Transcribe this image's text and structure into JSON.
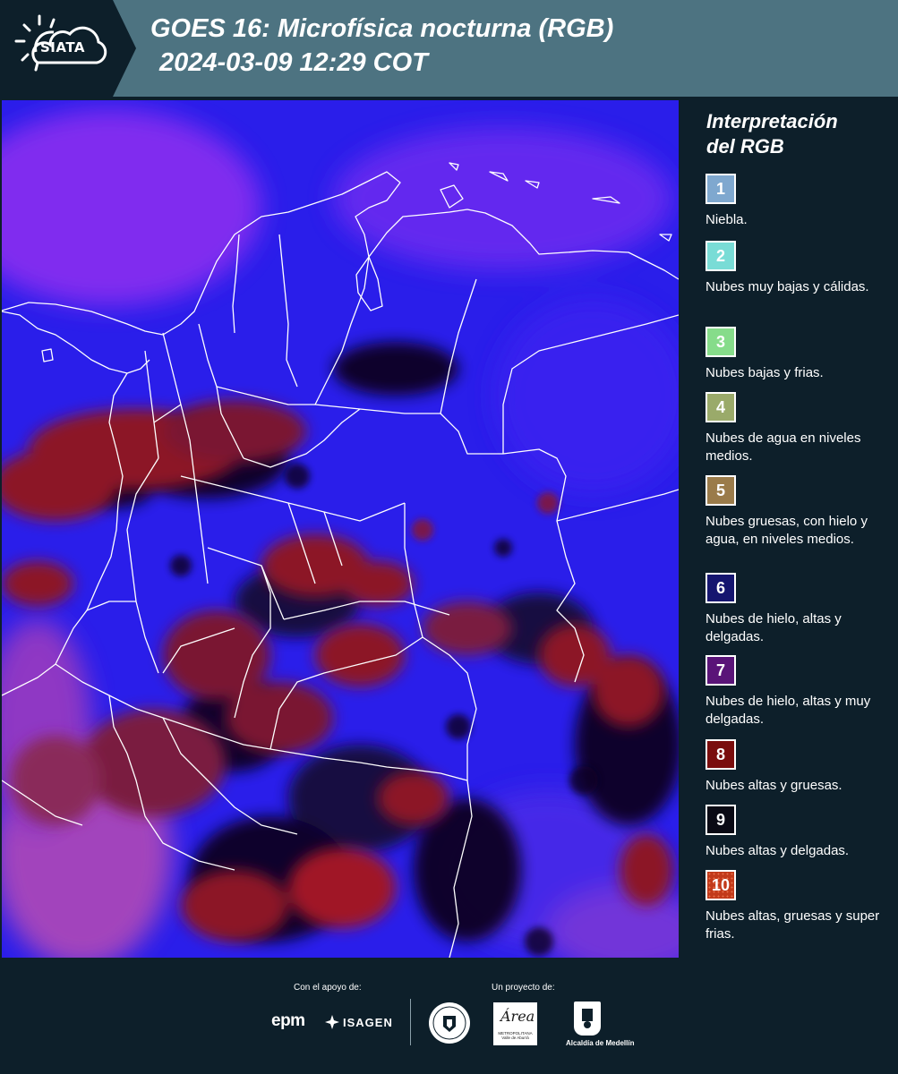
{
  "header": {
    "logo_text": "SIATA",
    "title_line1": "GOES 16: Microfísica nocturna (RGB)",
    "title_line2": "2024-03-09 12:29 COT",
    "bg_color": "#4d7381"
  },
  "map": {
    "description_icon": "satellite-rgb-map",
    "colors": {
      "base_blue": "#2a1eea",
      "violet": "#8a2df0",
      "dark_red": "#8c1626",
      "black": "#0a0520",
      "border_line": "#ffffff"
    }
  },
  "legend": {
    "title_line1": "Interpretación",
    "title_line2": "del RGB",
    "items": [
      {
        "number": "1",
        "label": "Niebla.",
        "color": "#7fa8cf"
      },
      {
        "number": "2",
        "label": "Nubes muy bajas y cálidas.",
        "color": "#79dcd6"
      },
      {
        "number": "3",
        "label": "Nubes bajas y frias.",
        "color": "#86dc8a"
      },
      {
        "number": "4",
        "label": "Nubes de agua en niveles medios.",
        "color": "#9aaa6a"
      },
      {
        "number": "5",
        "label": "Nubes gruesas, con hielo y agua, en niveles medios.",
        "color": "#9a7b4a"
      },
      {
        "number": "6",
        "label": "Nubes de hielo, altas y delgadas.",
        "color": "#15156f"
      },
      {
        "number": "7",
        "label": "Nubes de hielo, altas y muy delgadas.",
        "color": "#5a1478"
      },
      {
        "number": "8",
        "label": "Nubes altas y gruesas.",
        "color": "#7a0d0d"
      },
      {
        "number": "9",
        "label": "Nubes altas y delgadas.",
        "color": "#0a0a14"
      },
      {
        "number": "10",
        "label": "Nubes altas, gruesas y super frias.",
        "color": "#c23a1a"
      }
    ]
  },
  "footer": {
    "support_label": "Con el apoyo de:",
    "project_label": "Un proyecto de:",
    "sponsor1": "epm",
    "sponsor2": "ISAGEN",
    "area_logo_text": "Área",
    "area_logo_sub": "METROPOLITANA Valle de Aburrá",
    "alcaldia_text": "Alcaldía de Medellín"
  }
}
